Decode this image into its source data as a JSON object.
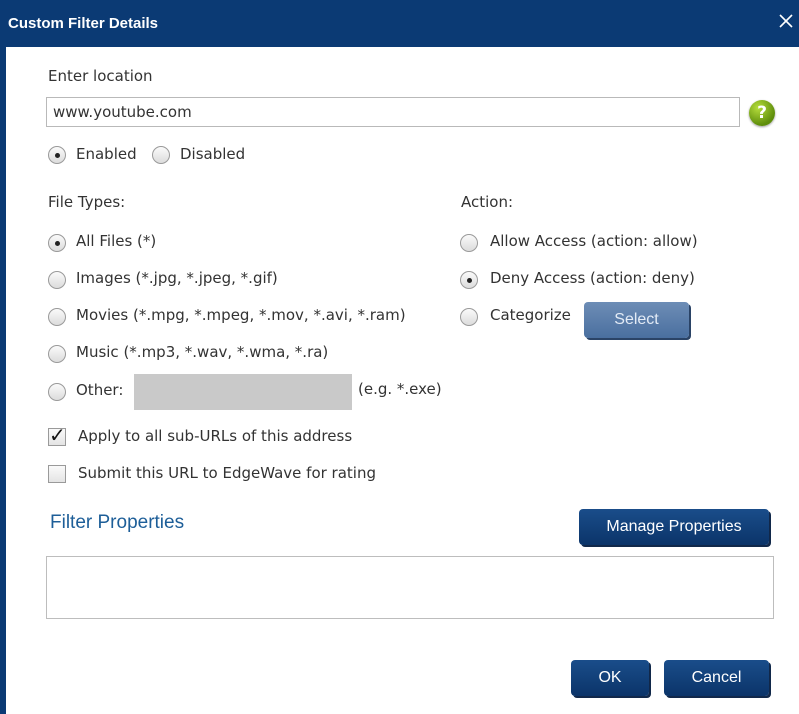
{
  "dialog": {
    "title": "Custom Filter Details",
    "close_icon": "close-icon"
  },
  "location": {
    "label": "Enter location",
    "value": "www.youtube.com",
    "help_text": "?"
  },
  "status": {
    "enabled_label": "Enabled",
    "disabled_label": "Disabled",
    "selected": "Enabled"
  },
  "file_types": {
    "label": "File Types:",
    "options": [
      {
        "label": "All Files (*)",
        "checked": true
      },
      {
        "label": "Images (*.jpg, *.jpeg, *.gif)",
        "checked": false
      },
      {
        "label": "Movies (*.mpg, *.mpeg, *.mov, *.avi, *.ram)",
        "checked": false
      },
      {
        "label": "Music (*.mp3, *.wav, *.wma, *.ra)",
        "checked": false
      },
      {
        "label": "Other:",
        "checked": false
      }
    ],
    "other_hint": "(e.g. *.exe)",
    "other_value": ""
  },
  "action": {
    "label": "Action:",
    "options": [
      {
        "label": "Allow Access (action: allow)",
        "checked": false
      },
      {
        "label": "Deny Access (action: deny)",
        "checked": true
      },
      {
        "label": "Categorize",
        "checked": false
      }
    ],
    "select_button": "Select"
  },
  "options": {
    "apply_sub_urls": {
      "label": "Apply to all sub-URLs of this address",
      "checked": true
    },
    "submit_rating": {
      "label": "Submit this URL to EdgeWave for rating",
      "checked": false
    }
  },
  "filter_properties": {
    "title": "Filter Properties",
    "manage_button": "Manage Properties"
  },
  "footer": {
    "ok_label": "OK",
    "cancel_label": "Cancel"
  },
  "colors": {
    "titlebar": "#0b3a74",
    "section_title": "#1d5e98",
    "help_icon": "#6a9a12"
  }
}
